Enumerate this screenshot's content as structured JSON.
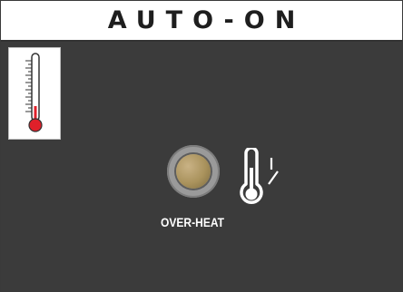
{
  "header": {
    "title": "AUTO-ON"
  },
  "indicator": {
    "label": "OVER-HEAT",
    "lamp_color": "#b09a68"
  },
  "icons": {
    "mode_icon": "thermometer-icon",
    "sensor_icon": "thermometer-switch-icon"
  },
  "colors": {
    "background": "#3b3b3b",
    "title_bar": "#ffffff",
    "thermometer_bulb": "#e0202a"
  }
}
